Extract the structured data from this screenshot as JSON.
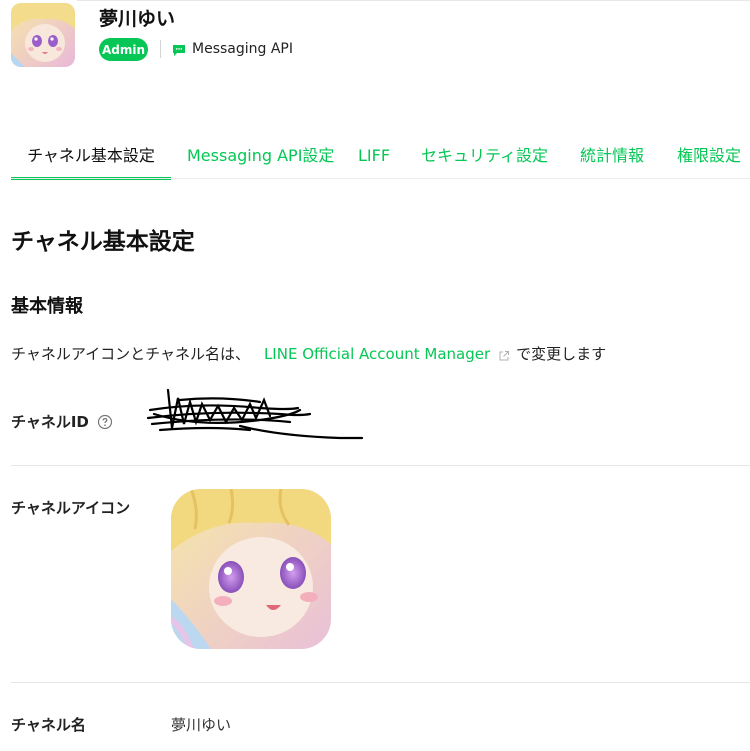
{
  "header": {
    "channel_name": "夢川ゆい",
    "badge": "Admin",
    "api_label": "Messaging API",
    "icons": {
      "avatar": "channel-avatar-image",
      "api": "chat-bubble-icon"
    }
  },
  "tabs": [
    {
      "label": "チャネル基本設定",
      "active": true
    },
    {
      "label": "Messaging API設定",
      "active": false
    },
    {
      "label": "LIFF",
      "active": false
    },
    {
      "label": "セキュリティ設定",
      "active": false
    },
    {
      "label": "統計情報",
      "active": false
    },
    {
      "label": "権限設定",
      "active": false
    }
  ],
  "main": {
    "page_title": "チャネル基本設定",
    "section_title": "基本情報",
    "info": {
      "prefix": "チャネルアイコンとチャネル名は、",
      "link": "LINE Official Account Manager",
      "suffix": "で変更します"
    },
    "rows": {
      "channel_id_label": "チャネルID",
      "channel_icon_label": "チャネルアイコン",
      "channel_name_label": "チャネル名",
      "channel_name_value": "夢川ゆい"
    }
  },
  "colors": {
    "accent": "#06c755",
    "text": "#111111",
    "divider": "#e6e6e6"
  }
}
